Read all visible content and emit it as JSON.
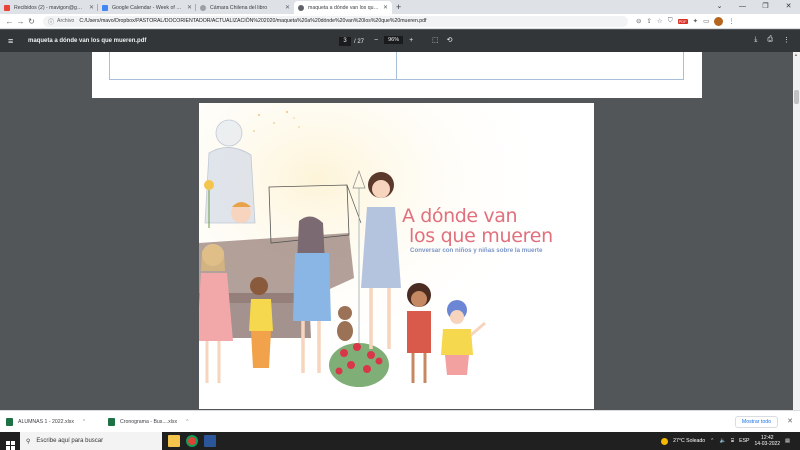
{
  "tabs": [
    {
      "title": "Recibidos (2) - mavigon@gmail.c",
      "color": "#ea4335",
      "active": false
    },
    {
      "title": "Google Calendar - Week of Marc",
      "color": "#4285f4",
      "active": false
    },
    {
      "title": "Cámara Chilena del libro",
      "color": "#5f6368",
      "active": false
    },
    {
      "title": "maqueta a dónde van los que mu",
      "color": "#5f6368",
      "active": true
    }
  ],
  "address": {
    "scheme": "Archivo",
    "url": "C:/Users/mavo/Dropbox/PASTORAL/DOCORIENTADOR/ACTUALIZACIÓN%202020/maqueta%20a%20dónde%20van%20los%20que%20mueren.pdf"
  },
  "pdf": {
    "filename": "maqueta a dónde van los que mueren.pdf",
    "page_current": "3",
    "page_total": "/ 27",
    "zoom": "96%"
  },
  "cover": {
    "title_line1": "A dónde van",
    "title_line2": "los que mueren",
    "subtitle": "Conversar con niños y niñas sobre la muerte"
  },
  "downloads": [
    {
      "name": "ALUMNAS 1 - 2022.xlsx"
    },
    {
      "name": "Cronograma - Bus....xlsx"
    }
  ],
  "downloads_show_all": "Mostrar todo",
  "taskbar": {
    "search_placeholder": "Escribe aquí para buscar",
    "weather": "27°C  Soleado",
    "lang": "ESP",
    "time": "12:42",
    "date": "14-03-2022"
  },
  "colors": {
    "accent": "#1a73e8",
    "title": "#e0707d",
    "subtitle": "#7b96c9"
  }
}
